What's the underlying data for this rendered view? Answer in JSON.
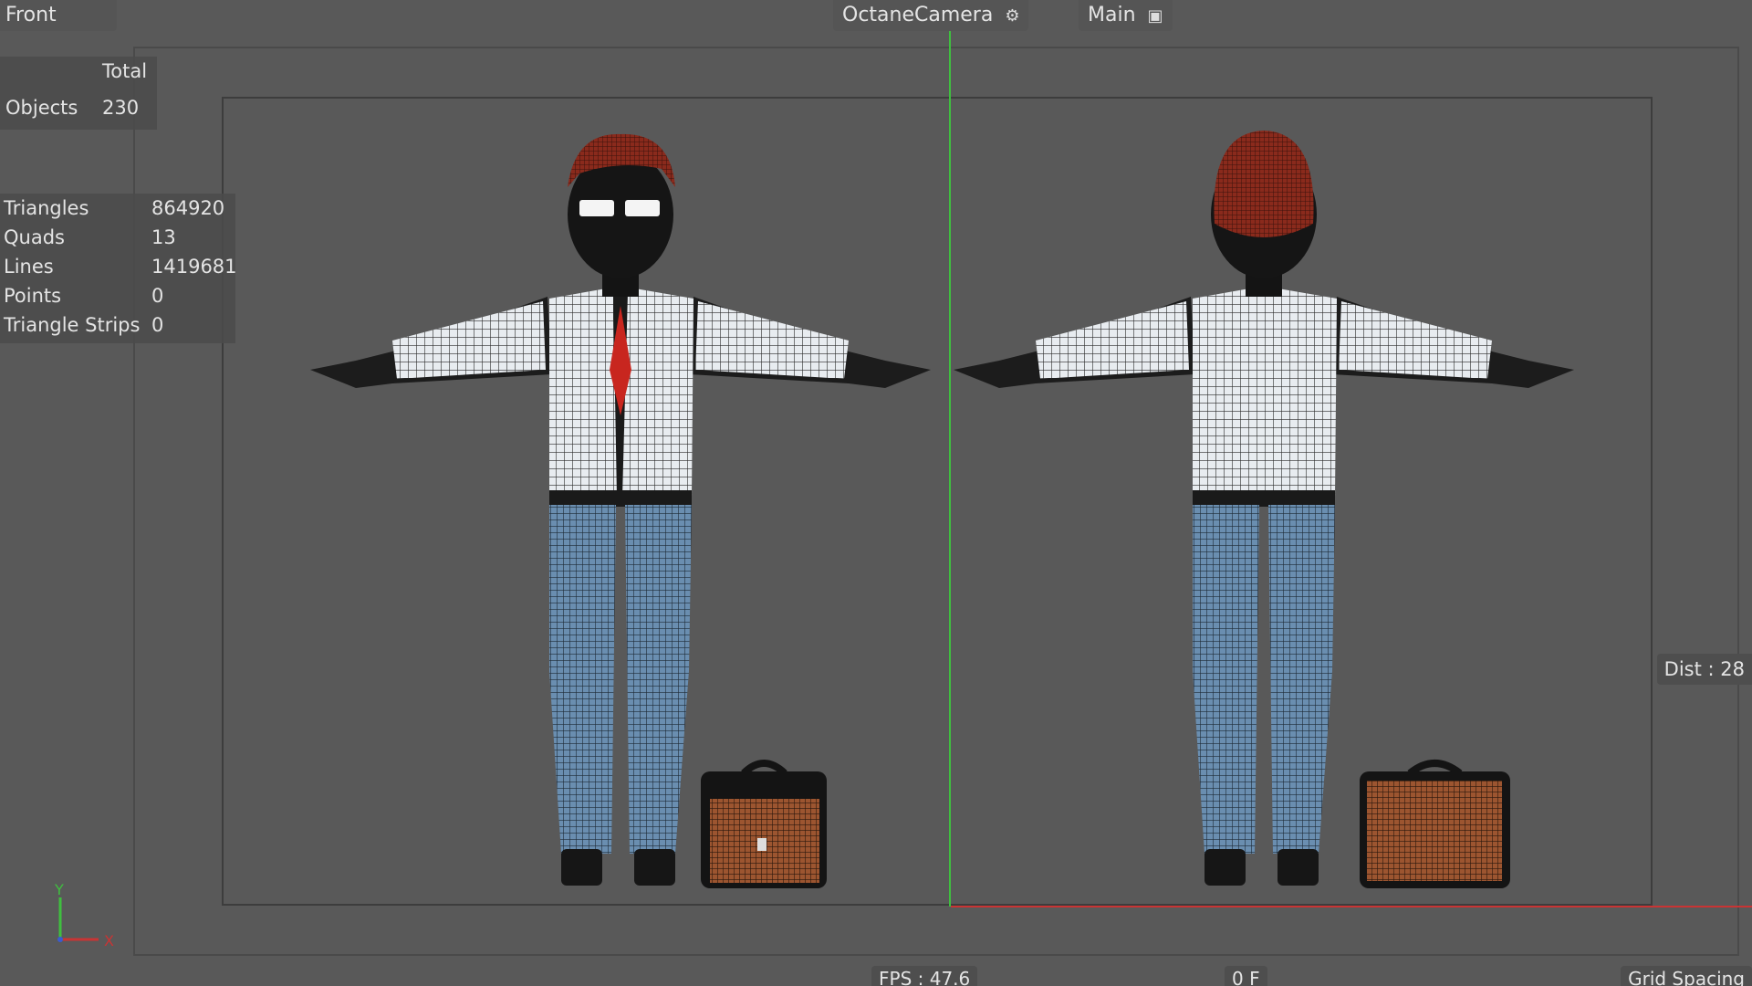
{
  "viewport": {
    "view_name": "Front",
    "camera_label": "OctaneCamera",
    "take_label": "Main",
    "camera_icon": "camera-icon",
    "take_icon": "clapperboard-icon"
  },
  "stats_objects": {
    "header": "Total",
    "label": "Objects",
    "value": "230"
  },
  "stats_polys": [
    {
      "label": "Triangles",
      "value": "864920"
    },
    {
      "label": "Quads",
      "value": "13"
    },
    {
      "label": "Lines",
      "value": "1419681"
    },
    {
      "label": "Points",
      "value": "0"
    },
    {
      "label": "Triangle Strips",
      "value": "0"
    }
  ],
  "hud": {
    "dist": "Dist : 28",
    "fps": "FPS : 47.6",
    "frame": "0 F",
    "grid_spacing": "Grid Spacing"
  },
  "gizmo": {
    "y_label": "Y",
    "x_label": "X"
  },
  "colors": {
    "viewport_bg": "#595959",
    "y_axis": "#3fbf3f",
    "x_axis": "#c93434",
    "shirt": "#dfe4ea",
    "pants": "#5a7fa0",
    "tie": "#c8261f",
    "hair": "#7a2a1e",
    "bag": "#8a4a2a"
  }
}
